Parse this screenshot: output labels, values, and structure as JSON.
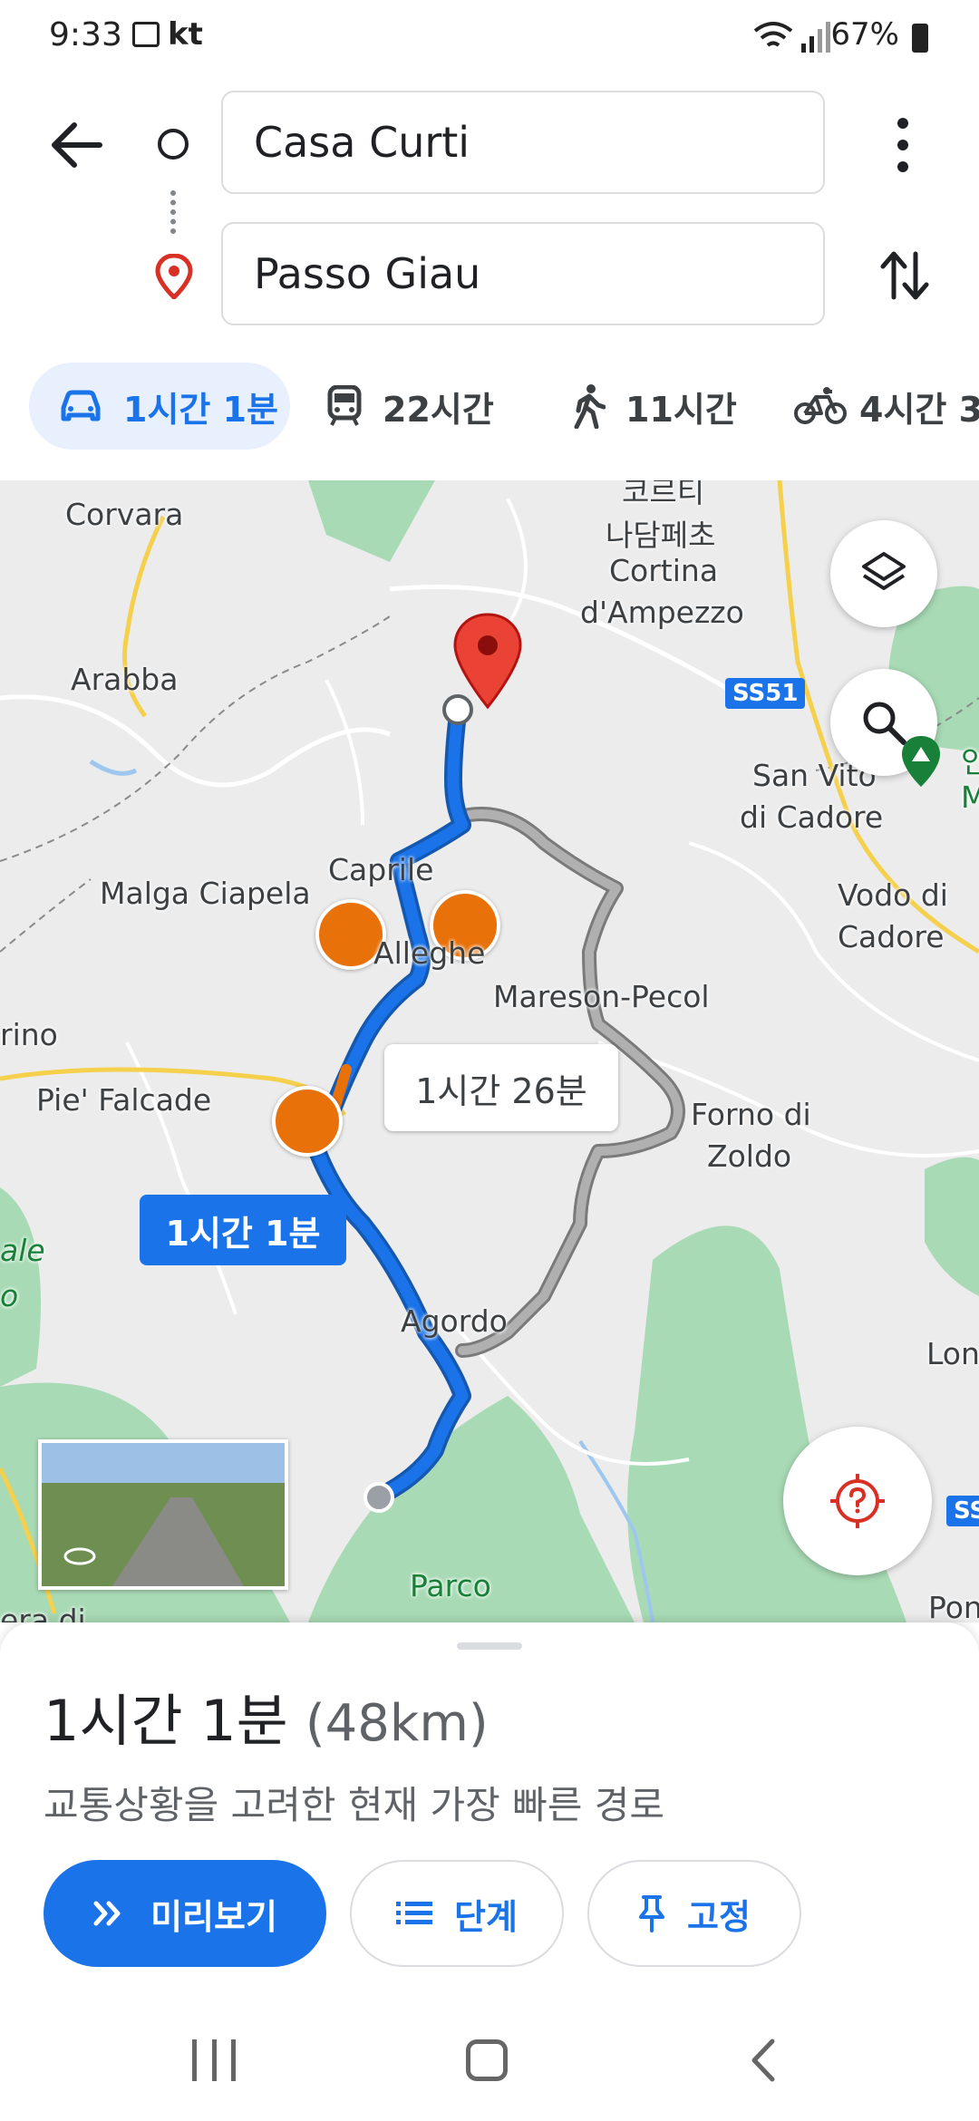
{
  "status_bar": {
    "time": "9:33",
    "carrier": "kt",
    "battery": "67%"
  },
  "header": {
    "origin": "Casa Curti",
    "destination": "Passo Giau"
  },
  "modes": [
    {
      "label": "1시간 1분",
      "icon": "car-icon"
    },
    {
      "label": "22시간",
      "icon": "train-icon"
    },
    {
      "label": "11시간",
      "icon": "walk-icon"
    },
    {
      "label": "4시간 3",
      "icon": "bike-icon"
    }
  ],
  "map": {
    "labels": {
      "corvara": "Corvara",
      "cortina_ko": "코르티",
      "cortina_ko2": "나담페초",
      "cortina": "Cortina",
      "dampezzo": "d'Ampezzo",
      "arabba": "Arabba",
      "ss51": "SS51",
      "san_vito": "San Vito",
      "di_cadore": "di Cadore",
      "caprile": "Caprile",
      "malga": "Malga Ciapela",
      "vodo": "Vodo di",
      "vodo_cadore": "Cadore",
      "alleghe": "Alleghe",
      "mareson": "Mareson-Pecol",
      "rino": "rino",
      "pie_falcade": "Pie' Falcade",
      "forno": "Forno di",
      "zoldo": "Zoldo",
      "agordo": "Agordo",
      "lon": "Lon",
      "parco": "Parco",
      "ss_right": "SS",
      "pon": "Pon",
      "era_di": "era di",
      "ale": "ale",
      "o": "o",
      "green_in": "인",
      "green_m": "M"
    },
    "alt_route_label": "1시간 26분",
    "main_route_label": "1시간 1분"
  },
  "sheet": {
    "duration": "1시간 1분",
    "distance": "(48km)",
    "description": "교통상황을 고려한 현재 가장 빠른 경로",
    "buttons": {
      "preview": "미리보기",
      "steps": "단계",
      "pin": "고정"
    }
  },
  "colors": {
    "accent": "#1a73e8",
    "route_main": "#1a73e8",
    "route_alt": "#9aa0a6",
    "pin": "#ea4335"
  }
}
